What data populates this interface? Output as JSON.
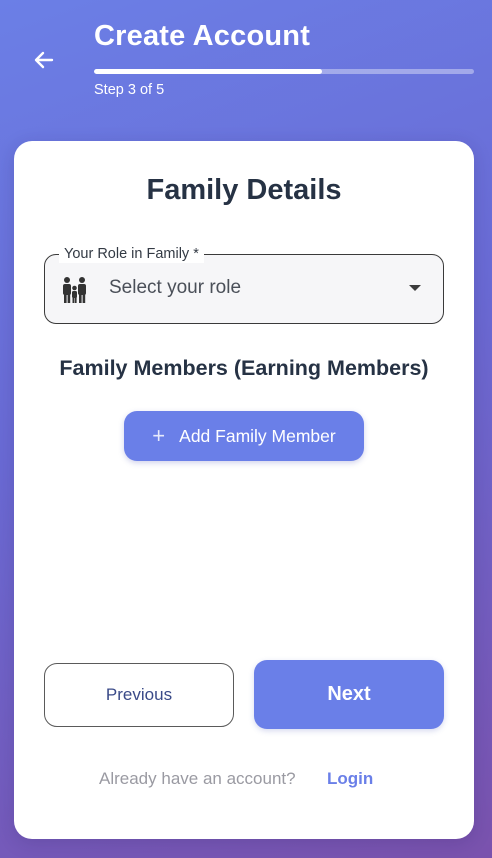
{
  "header": {
    "title": "Create Account",
    "step_text": "Step 3 of 5",
    "progress_fraction": 0.6,
    "back_icon": "arrow-left-icon"
  },
  "card": {
    "title": "Family Details",
    "role_field": {
      "label": "Your Role in Family *",
      "placeholder": "Select your role",
      "icon": "family-icon"
    },
    "members_heading": "Family Members (Earning Members)",
    "add_member_label": "Add Family Member",
    "previous_label": "Previous",
    "next_label": "Next",
    "footer_text": "Already have an account?",
    "login_label": "Login"
  },
  "colors": {
    "accent": "#6a7fe8",
    "gradient_start": "#6b7fe6",
    "gradient_end": "#7a52ad",
    "heading_text": "#263244"
  }
}
